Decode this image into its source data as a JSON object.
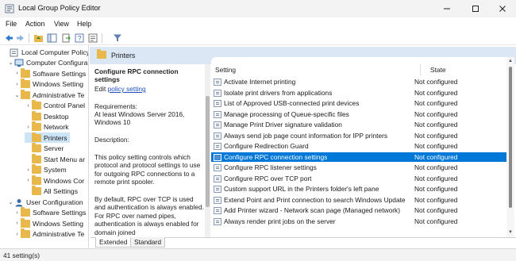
{
  "window": {
    "title": "Local Group Policy Editor",
    "controls": [
      "minimize-icon",
      "maximize-icon",
      "close-icon"
    ]
  },
  "menu": [
    "File",
    "Action",
    "View",
    "Help"
  ],
  "toolbar": {
    "icons": [
      "back-arrow-icon",
      "forward-arrow-icon",
      "up-folder-icon",
      "show-hide-tree-icon",
      "export-list-icon",
      "help-icon",
      "properties-icon",
      "filter-icon"
    ]
  },
  "tree": {
    "items": [
      {
        "label": "Local Computer Policy",
        "level": 0,
        "expander": "",
        "icon": "policy-icon"
      },
      {
        "label": "Computer Configura",
        "level": 1,
        "expander": "v",
        "icon": "computer-icon"
      },
      {
        "label": "Software Settings",
        "level": 2,
        "expander": ">",
        "icon": "folder-icon"
      },
      {
        "label": "Windows Setting",
        "level": 2,
        "expander": ">",
        "icon": "folder-icon"
      },
      {
        "label": "Administrative Te",
        "level": 2,
        "expander": "v",
        "icon": "folder-icon"
      },
      {
        "label": "Control Panel",
        "level": 3,
        "expander": ">",
        "icon": "folder-icon"
      },
      {
        "label": "Desktop",
        "level": 3,
        "expander": "",
        "icon": "folder-icon"
      },
      {
        "label": "Network",
        "level": 3,
        "expander": ">",
        "icon": "folder-icon"
      },
      {
        "label": "Printers",
        "level": 3,
        "expander": "",
        "icon": "folder-icon",
        "selected": true
      },
      {
        "label": "Server",
        "level": 3,
        "expander": "",
        "icon": "folder-icon"
      },
      {
        "label": "Start Menu ar",
        "level": 3,
        "expander": "",
        "icon": "folder-icon"
      },
      {
        "label": "System",
        "level": 3,
        "expander": ">",
        "icon": "folder-icon"
      },
      {
        "label": "Windows Cor",
        "level": 3,
        "expander": ">",
        "icon": "folder-icon"
      },
      {
        "label": "All Settings",
        "level": 3,
        "expander": "",
        "icon": "folder-icon"
      },
      {
        "label": "User Configuration",
        "level": 1,
        "expander": "v",
        "icon": "user-icon"
      },
      {
        "label": "Software Settings",
        "level": 2,
        "expander": ">",
        "icon": "folder-icon"
      },
      {
        "label": "Windows Setting",
        "level": 2,
        "expander": ">",
        "icon": "folder-icon"
      },
      {
        "label": "Administrative Te",
        "level": 2,
        "expander": ">",
        "icon": "folder-icon"
      }
    ]
  },
  "pane": {
    "header": "Printers"
  },
  "description": {
    "title": "Configure RPC connection settings",
    "edit_prefix": "Edit ",
    "edit_link": "policy setting",
    "req_label": "Requirements:",
    "req_text": "At least Windows Server 2016, Windows 10",
    "desc_label": "Description:",
    "para1": "This policy setting controls which protocol and protocol settings to use for outgoing RPC connections to a remote print spooler.",
    "para2": "By default, RPC over TCP is used and authentication is always enabled. For RPC over named pipes, authentication is always enabled for domain joined"
  },
  "list": {
    "col_setting": "Setting",
    "col_state": "State",
    "rows": [
      {
        "name": "Activate Internet printing",
        "state": "Not configured"
      },
      {
        "name": "Isolate print drivers from applications",
        "state": "Not configured"
      },
      {
        "name": "List of Approved USB-connected print devices",
        "state": "Not configured"
      },
      {
        "name": "Manage processing of Queue-specific files",
        "state": "Not configured"
      },
      {
        "name": "Manage Print Driver signature validation",
        "state": "Not configured"
      },
      {
        "name": "Always send job page count information for IPP printers",
        "state": "Not configured"
      },
      {
        "name": "Configure Redirection Guard",
        "state": "Not configured"
      },
      {
        "name": "Configure RPC connection settings",
        "state": "Not configured",
        "selected": true
      },
      {
        "name": "Configure RPC listener settings",
        "state": "Not configured"
      },
      {
        "name": "Configure RPC over TCP port",
        "state": "Not configured"
      },
      {
        "name": "Custom support URL in the Printers folder's left pane",
        "state": "Not configured"
      },
      {
        "name": "Extend Point and Print connection to search Windows Update",
        "state": "Not configured"
      },
      {
        "name": "Add Printer wizard - Network scan page (Managed network)",
        "state": "Not configured"
      },
      {
        "name": "Always render print jobs on the server",
        "state": "Not configured"
      }
    ]
  },
  "tabs": [
    "Extended",
    "Standard"
  ],
  "status": "41 setting(s)",
  "colors": {
    "selection": "#0078d7",
    "header": "#dbe7f4",
    "folder": "#e8b84a",
    "link": "#1f4fc1"
  }
}
